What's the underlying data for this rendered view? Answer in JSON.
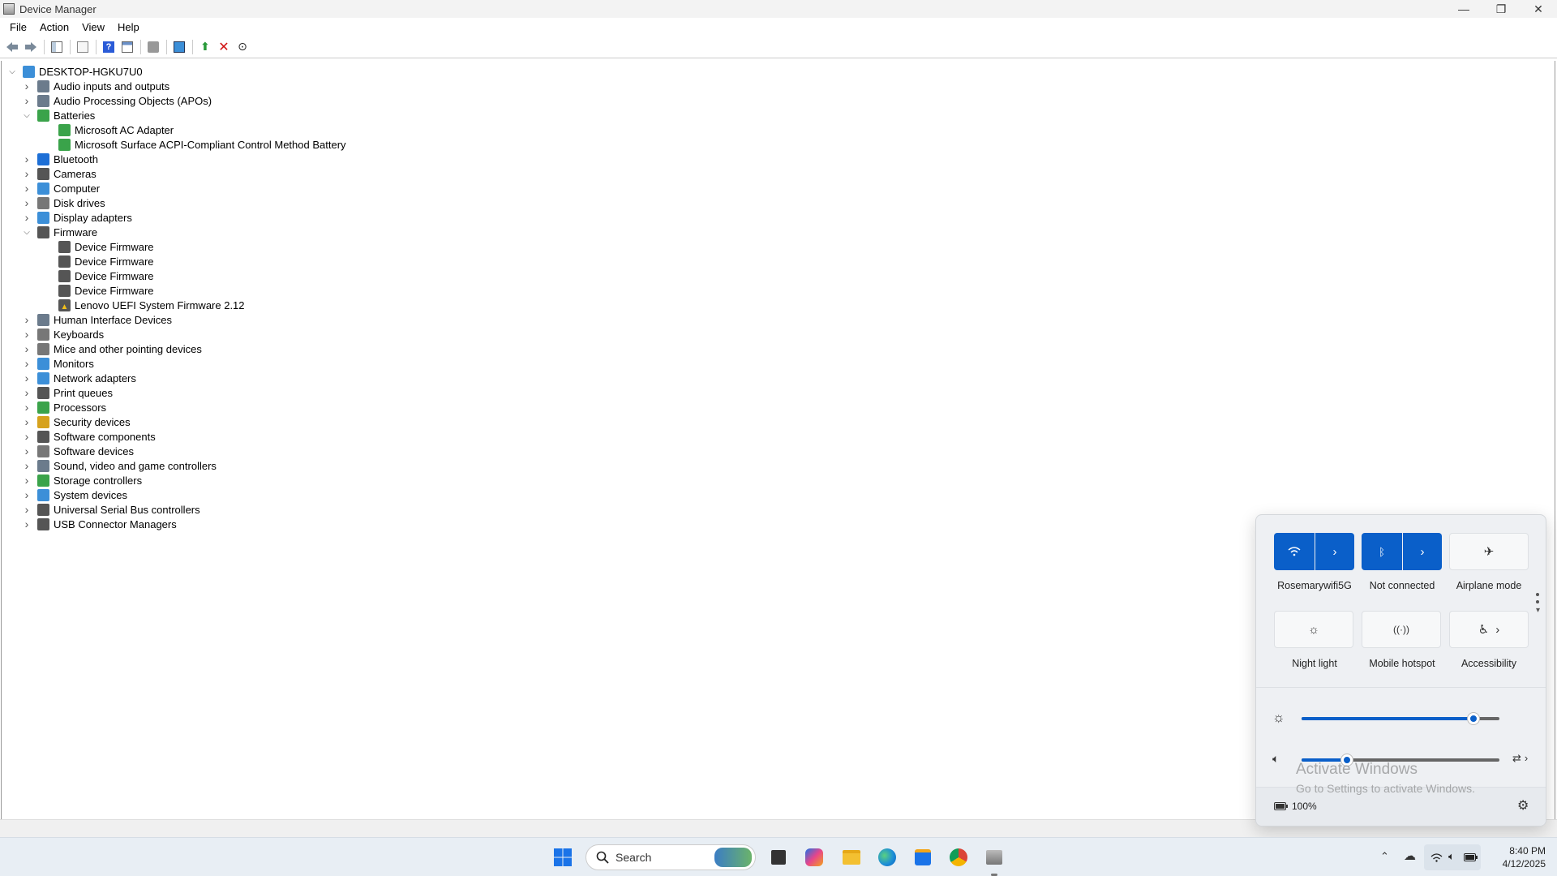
{
  "window": {
    "title": "Device Manager",
    "controls": [
      "—",
      "❐",
      "✕"
    ]
  },
  "menu": [
    "File",
    "Action",
    "View",
    "Help"
  ],
  "tree": {
    "root": "DESKTOP-HGKU7U0",
    "rows": [
      {
        "label": "Audio inputs and outputs",
        "level": 1,
        "state": "collapsed",
        "icon": "speaker-icon",
        "color": "#6b7b8c"
      },
      {
        "label": "Audio Processing Objects (APOs)",
        "level": 1,
        "state": "collapsed",
        "icon": "speaker-icon",
        "color": "#6b7b8c"
      },
      {
        "label": "Batteries",
        "level": 1,
        "state": "expanded",
        "icon": "battery-icon",
        "color": "#3aa34a"
      },
      {
        "label": "Microsoft AC Adapter",
        "level": 2,
        "state": "leaf",
        "icon": "battery-icon",
        "color": "#3aa34a"
      },
      {
        "label": "Microsoft Surface ACPI-Compliant Control Method Battery",
        "level": 2,
        "state": "leaf",
        "icon": "battery-icon",
        "color": "#3aa34a"
      },
      {
        "label": "Bluetooth",
        "level": 1,
        "state": "collapsed",
        "icon": "bluetooth-icon",
        "color": "#1d6fd6"
      },
      {
        "label": "Cameras",
        "level": 1,
        "state": "collapsed",
        "icon": "camera-icon",
        "color": "#555555"
      },
      {
        "label": "Computer",
        "level": 1,
        "state": "collapsed",
        "icon": "computer-icon",
        "color": "#3c8fd8"
      },
      {
        "label": "Disk drives",
        "level": 1,
        "state": "collapsed",
        "icon": "disk-icon",
        "color": "#777777"
      },
      {
        "label": "Display adapters",
        "level": 1,
        "state": "collapsed",
        "icon": "display-icon",
        "color": "#3c8fd8"
      },
      {
        "label": "Firmware",
        "level": 1,
        "state": "expanded",
        "icon": "chip-icon",
        "color": "#555555"
      },
      {
        "label": "Device Firmware",
        "level": 2,
        "state": "leaf",
        "icon": "chip-icon",
        "color": "#555555"
      },
      {
        "label": "Device Firmware",
        "level": 2,
        "state": "leaf",
        "icon": "chip-icon",
        "color": "#555555"
      },
      {
        "label": "Device Firmware",
        "level": 2,
        "state": "leaf",
        "icon": "chip-icon",
        "color": "#555555"
      },
      {
        "label": "Device Firmware",
        "level": 2,
        "state": "leaf",
        "icon": "chip-icon",
        "color": "#555555"
      },
      {
        "label": "Lenovo UEFI System Firmware 2.12",
        "level": 2,
        "state": "leaf",
        "icon": "chip-warning-icon",
        "color": "#555555"
      },
      {
        "label": "Human Interface Devices",
        "level": 1,
        "state": "collapsed",
        "icon": "hid-icon",
        "color": "#6b7b8c"
      },
      {
        "label": "Keyboards",
        "level": 1,
        "state": "collapsed",
        "icon": "keyboard-icon",
        "color": "#777777"
      },
      {
        "label": "Mice and other pointing devices",
        "level": 1,
        "state": "collapsed",
        "icon": "mouse-icon",
        "color": "#777777"
      },
      {
        "label": "Monitors",
        "level": 1,
        "state": "collapsed",
        "icon": "monitor-icon",
        "color": "#3c8fd8"
      },
      {
        "label": "Network adapters",
        "level": 1,
        "state": "collapsed",
        "icon": "network-icon",
        "color": "#3c8fd8"
      },
      {
        "label": "Print queues",
        "level": 1,
        "state": "collapsed",
        "icon": "printer-icon",
        "color": "#555555"
      },
      {
        "label": "Processors",
        "level": 1,
        "state": "collapsed",
        "icon": "processor-icon",
        "color": "#3aa34a"
      },
      {
        "label": "Security devices",
        "level": 1,
        "state": "collapsed",
        "icon": "security-icon",
        "color": "#d6a21d"
      },
      {
        "label": "Software components",
        "level": 1,
        "state": "collapsed",
        "icon": "component-icon",
        "color": "#555555"
      },
      {
        "label": "Software devices",
        "level": 1,
        "state": "collapsed",
        "icon": "software-device-icon",
        "color": "#777777"
      },
      {
        "label": "Sound, video and game controllers",
        "level": 1,
        "state": "collapsed",
        "icon": "speaker-icon",
        "color": "#6b7b8c"
      },
      {
        "label": "Storage controllers",
        "level": 1,
        "state": "collapsed",
        "icon": "storage-icon",
        "color": "#3aa34a"
      },
      {
        "label": "System devices",
        "level": 1,
        "state": "collapsed",
        "icon": "system-icon",
        "color": "#3c8fd8"
      },
      {
        "label": "Universal Serial Bus controllers",
        "level": 1,
        "state": "collapsed",
        "icon": "usb-icon",
        "color": "#555555"
      },
      {
        "label": "USB Connector Managers",
        "level": 1,
        "state": "collapsed",
        "icon": "usb-icon",
        "color": "#555555"
      }
    ]
  },
  "quick_settings": {
    "wifi_label": "Rosemarywifi5G",
    "bluetooth_label": "Not connected",
    "airplane_label": "Airplane mode",
    "night_light_label": "Night light",
    "hotspot_label": "Mobile hotspot",
    "accessibility_label": "Accessibility",
    "brightness_fraction": 0.87,
    "volume_fraction": 0.23,
    "battery_label": "100%",
    "accent": "#0a5fc9"
  },
  "watermark": {
    "line1": "Activate Windows",
    "line2": "Go to Settings to activate Windows."
  },
  "taskbar": {
    "search_label": "Search",
    "time": "8:40 PM",
    "date": "4/12/2025"
  }
}
